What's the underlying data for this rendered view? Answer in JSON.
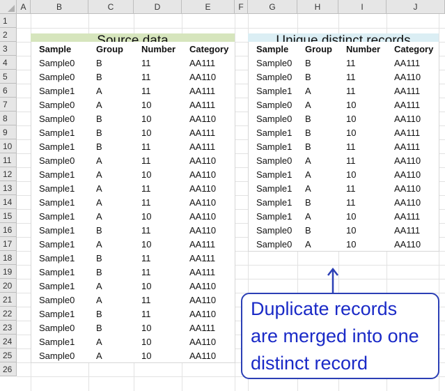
{
  "columns": [
    "A",
    "B",
    "C",
    "D",
    "E",
    "F",
    "G",
    "H",
    "I",
    "J"
  ],
  "rows": [
    "1",
    "2",
    "3",
    "4",
    "5",
    "6",
    "7",
    "8",
    "9",
    "10",
    "11",
    "12",
    "13",
    "14",
    "15",
    "16",
    "17",
    "18",
    "19",
    "20",
    "21",
    "22",
    "23",
    "24",
    "25",
    "26"
  ],
  "source": {
    "title": "Source data",
    "title_color": "#d6e5bd",
    "headers": [
      "Sample",
      "Group",
      "Number",
      "Category"
    ],
    "records": [
      [
        "Sample0",
        "B",
        "11",
        "AA111"
      ],
      [
        "Sample0",
        "B",
        "11",
        "AA110"
      ],
      [
        "Sample1",
        "A",
        "11",
        "AA111"
      ],
      [
        "Sample0",
        "A",
        "10",
        "AA111"
      ],
      [
        "Sample0",
        "B",
        "10",
        "AA110"
      ],
      [
        "Sample1",
        "B",
        "10",
        "AA111"
      ],
      [
        "Sample1",
        "B",
        "11",
        "AA111"
      ],
      [
        "Sample0",
        "A",
        "11",
        "AA110"
      ],
      [
        "Sample1",
        "A",
        "10",
        "AA110"
      ],
      [
        "Sample1",
        "A",
        "11",
        "AA110"
      ],
      [
        "Sample1",
        "A",
        "11",
        "AA110"
      ],
      [
        "Sample1",
        "A",
        "10",
        "AA110"
      ],
      [
        "Sample1",
        "B",
        "11",
        "AA110"
      ],
      [
        "Sample1",
        "A",
        "10",
        "AA111"
      ],
      [
        "Sample1",
        "B",
        "11",
        "AA111"
      ],
      [
        "Sample1",
        "B",
        "11",
        "AA111"
      ],
      [
        "Sample1",
        "A",
        "10",
        "AA110"
      ],
      [
        "Sample0",
        "A",
        "11",
        "AA110"
      ],
      [
        "Sample1",
        "B",
        "11",
        "AA110"
      ],
      [
        "Sample0",
        "B",
        "10",
        "AA111"
      ],
      [
        "Sample1",
        "A",
        "10",
        "AA110"
      ],
      [
        "Sample0",
        "A",
        "10",
        "AA110"
      ]
    ]
  },
  "unique": {
    "title": "Unique distinct records",
    "title_color": "#dbeef4",
    "headers": [
      "Sample",
      "Group",
      "Number",
      "Category"
    ],
    "records": [
      [
        "Sample0",
        "B",
        "11",
        "AA111"
      ],
      [
        "Sample0",
        "B",
        "11",
        "AA110"
      ],
      [
        "Sample1",
        "A",
        "11",
        "AA111"
      ],
      [
        "Sample0",
        "A",
        "10",
        "AA111"
      ],
      [
        "Sample0",
        "B",
        "10",
        "AA110"
      ],
      [
        "Sample1",
        "B",
        "10",
        "AA111"
      ],
      [
        "Sample1",
        "B",
        "11",
        "AA111"
      ],
      [
        "Sample0",
        "A",
        "11",
        "AA110"
      ],
      [
        "Sample1",
        "A",
        "10",
        "AA110"
      ],
      [
        "Sample1",
        "A",
        "11",
        "AA110"
      ],
      [
        "Sample1",
        "B",
        "11",
        "AA110"
      ],
      [
        "Sample1",
        "A",
        "10",
        "AA111"
      ],
      [
        "Sample0",
        "B",
        "10",
        "AA111"
      ],
      [
        "Sample0",
        "A",
        "10",
        "AA110"
      ]
    ]
  },
  "callout": {
    "lines": [
      "Duplicate records",
      "are merged into one",
      "distinct record"
    ],
    "text_color": "#1a2ac7",
    "border_color": "#2b3fb5"
  }
}
